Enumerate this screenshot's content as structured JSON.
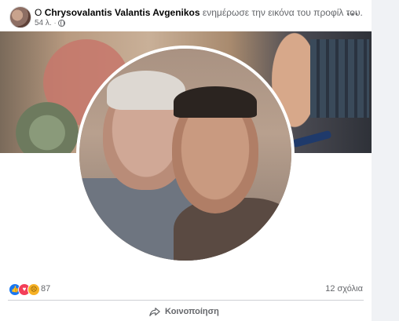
{
  "post": {
    "prefix": "Ο",
    "author": "Chrysovalantis Valantis Avgenikos",
    "action": "ενημέρωσε την εικόνα του προφίλ του.",
    "time": "54 λ.",
    "more_label": "···"
  },
  "engagement": {
    "reaction_count": "87",
    "comments": "12 σχόλια",
    "share_label": "Κοινοποίηση"
  },
  "icons": {
    "privacy": "globe-icon",
    "share": "share-arrow-icon",
    "reactions": [
      "like-icon",
      "love-icon",
      "sad-icon"
    ]
  },
  "colors": {
    "like": "#1877f2",
    "love": "#f33e58",
    "sad": "#f7b125",
    "secondary_text": "#65676b"
  }
}
